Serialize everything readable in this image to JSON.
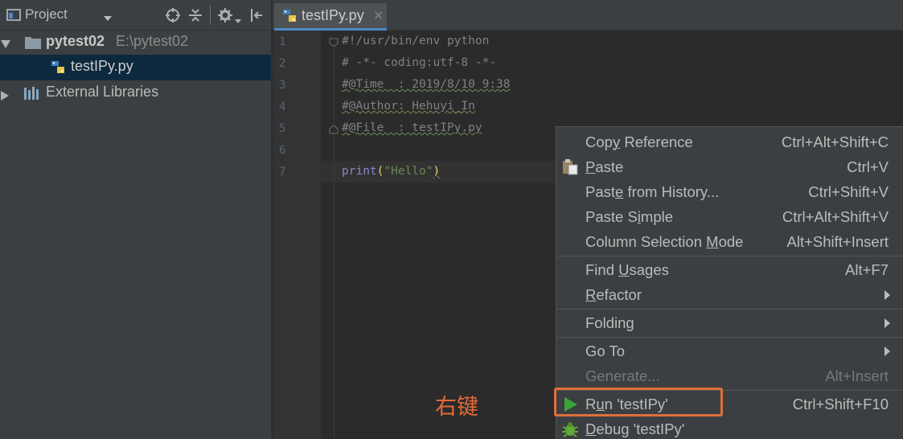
{
  "project_panel": {
    "title": "Project",
    "tree": [
      {
        "name": "pytest02",
        "path": "E:\\pytest02"
      },
      {
        "name": "testIPy.py"
      },
      {
        "name": "External Libraries"
      }
    ]
  },
  "editor": {
    "tab_label": "testIPy.py",
    "tab_close": "×",
    "line_numbers": [
      "1",
      "2",
      "3",
      "4",
      "5",
      "6",
      "7"
    ],
    "lines": {
      "l1": "#!/usr/bin/env python",
      "l2": "# -*- coding:utf-8 -*-",
      "l3": "#@Time  : 2019/8/10 9:38",
      "l4": "#@Author: Hehuyi_In",
      "l5": "#@File  : testIPy.py",
      "l7_print": "print",
      "l7_open": "(",
      "l7_str": "\"Hello\"",
      "l7_close": ")"
    }
  },
  "context_menu": {
    "copy_reference": {
      "pre": "Cop",
      "mn": "y",
      "post": " Reference",
      "shortcut": "Ctrl+Alt+Shift+C"
    },
    "paste": {
      "pre": "",
      "mn": "P",
      "post": "aste",
      "shortcut": "Ctrl+V"
    },
    "paste_history": {
      "pre": "Past",
      "mn": "e",
      "post": " from History...",
      "shortcut": "Ctrl+Shift+V"
    },
    "paste_simple": {
      "pre": "Paste S",
      "mn": "i",
      "post": "mple",
      "shortcut": "Ctrl+Alt+Shift+V"
    },
    "column_selection": {
      "pre": "Column Selection ",
      "mn": "M",
      "post": "ode",
      "shortcut": "Alt+Shift+Insert"
    },
    "find_usages": {
      "pre": "Find ",
      "mn": "U",
      "post": "sages",
      "shortcut": "Alt+F7"
    },
    "refactor": {
      "pre": "",
      "mn": "R",
      "post": "efactor"
    },
    "folding": {
      "label": "Folding"
    },
    "go_to": {
      "label": "Go To"
    },
    "generate": {
      "label": "Generate...",
      "shortcut": "Alt+Insert"
    },
    "run": {
      "pre": "R",
      "mn": "u",
      "post": "n 'testIPy'",
      "shortcut": "Ctrl+Shift+F10"
    },
    "debug": {
      "pre": "",
      "mn": "D",
      "post": "ebug 'testIPy'"
    }
  },
  "annotation": "右键",
  "colors": {
    "highlight": "#e0703a",
    "selection": "#0d293e",
    "run_icon": "#3aa53a"
  }
}
